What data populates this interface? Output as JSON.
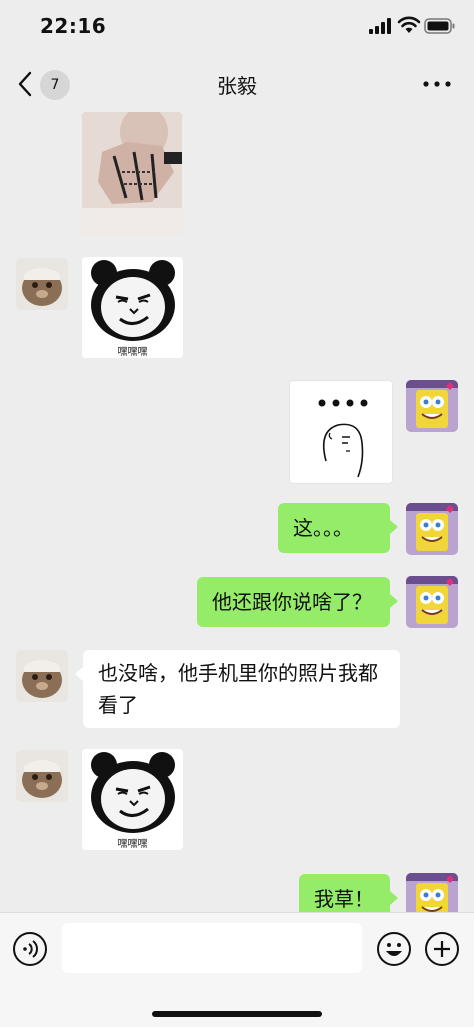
{
  "status_bar": {
    "time": "22:16"
  },
  "header": {
    "back_badge": "7",
    "title": "张毅"
  },
  "messages": [
    {
      "type": "image",
      "side": "left"
    },
    {
      "type": "sticker",
      "side": "left",
      "caption": "嘿嘿嘿"
    },
    {
      "type": "sticker",
      "side": "right",
      "content": "...."
    },
    {
      "type": "text",
      "side": "right",
      "text": "这。。。"
    },
    {
      "type": "text",
      "side": "right",
      "text": "他还跟你说啥了？"
    },
    {
      "type": "text",
      "side": "left",
      "text": "也没啥，他手机里你的照片我都看了"
    },
    {
      "type": "sticker",
      "side": "left",
      "caption": "嘿嘿嘿"
    },
    {
      "type": "text",
      "side": "right",
      "text": "我草！"
    }
  ],
  "input_bar": {
    "placeholder": ""
  },
  "colors": {
    "background": "#ededed",
    "sent_bubble": "#95ec69",
    "received_bubble": "#ffffff"
  }
}
